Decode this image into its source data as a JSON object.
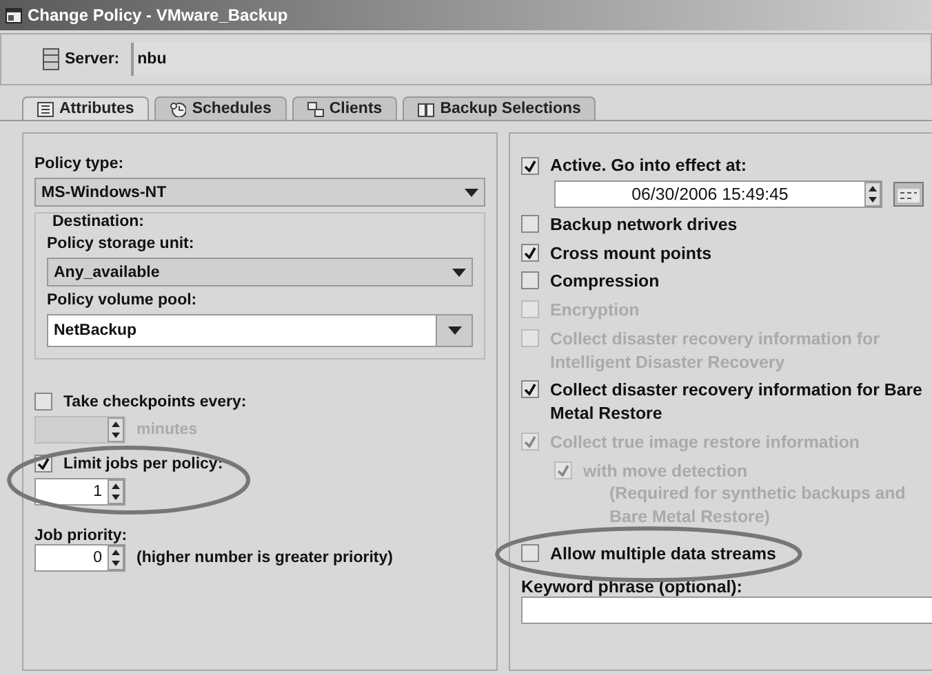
{
  "window": {
    "title": "Change Policy - VMware_Backup"
  },
  "server": {
    "label": "Server:",
    "value": "nbu"
  },
  "tabs": [
    {
      "label": "Attributes",
      "selected": true
    },
    {
      "label": "Schedules",
      "selected": false
    },
    {
      "label": "Clients",
      "selected": false
    },
    {
      "label": "Backup Selections",
      "selected": false
    }
  ],
  "policy_type": {
    "label": "Policy type:",
    "value": "MS-Windows-NT"
  },
  "destination": {
    "label": "Destination:",
    "storage_unit": {
      "label": "Policy storage unit:",
      "value": "Any_available"
    },
    "volume_pool": {
      "label": "Policy volume pool:",
      "value": "NetBackup"
    }
  },
  "checkpoints": {
    "label": "Take checkpoints every:",
    "checked": false,
    "unit": "minutes",
    "disabled": true
  },
  "limit_jobs": {
    "label": "Limit jobs per policy:",
    "checked": true,
    "value": "1",
    "circled": true
  },
  "job_priority": {
    "label": "Job priority:",
    "value": "0",
    "hint": "(higher number is greater priority)"
  },
  "active": {
    "label": "Active. Go into effect at:",
    "checked": true,
    "datetime": "06/30/2006 15:49:45"
  },
  "options": [
    {
      "label": "Backup network drives",
      "checked": false,
      "disabled": false
    },
    {
      "label": "Cross mount points",
      "checked": true,
      "disabled": false
    },
    {
      "label": "Compression",
      "checked": false,
      "disabled": false
    },
    {
      "label": "Encryption",
      "checked": false,
      "disabled": true
    },
    {
      "label": "Collect disaster recovery information for Intelligent Disaster Recovery",
      "checked": false,
      "disabled": true
    },
    {
      "label": "Collect disaster recovery information for Bare Metal Restore",
      "checked": true,
      "disabled": false
    },
    {
      "label": "Collect true image restore information",
      "checked": true,
      "disabled": true,
      "children": [
        {
          "label": "with move detection",
          "checked": true,
          "disabled": true,
          "note": "(Required for synthetic backups and Bare Metal Restore)"
        }
      ]
    },
    {
      "label": "Allow multiple data streams",
      "checked": false,
      "disabled": false,
      "circled": true
    }
  ],
  "keyword": {
    "label": "Keyword phrase (optional):"
  }
}
